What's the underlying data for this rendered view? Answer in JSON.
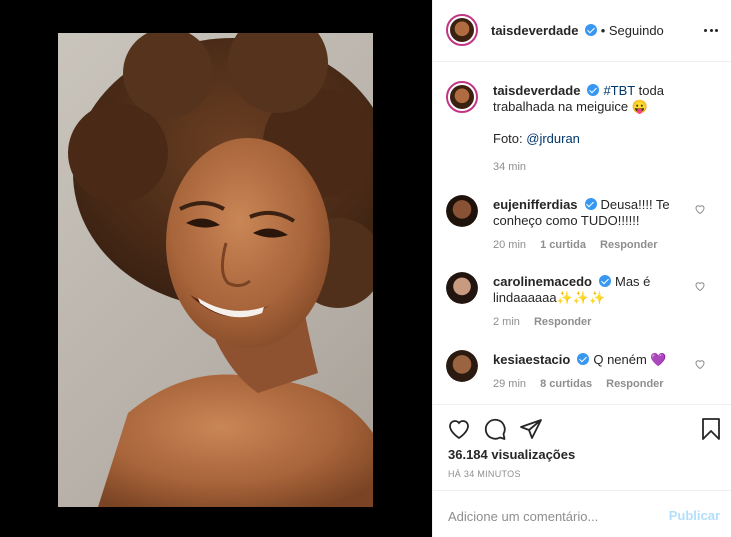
{
  "post": {
    "author": "taisdeverdade",
    "follow_status": "• Seguindo",
    "caption_username": "taisdeverdade",
    "caption_tag": "#TBT",
    "caption_text": "toda trabalhada na meiguice 😛",
    "caption_photo_prefix": "Foto:",
    "caption_photo_credit": "@jrduran",
    "caption_time": "34 min"
  },
  "comments": [
    {
      "username": "eujenifferdias",
      "text": "Deusa!!!! Te conheço como TUDO!!!!!!",
      "time": "20 min",
      "likes": "1 curtida",
      "reply": "Responder"
    },
    {
      "username": "carolinemacedo",
      "text": "Mas é lindaaaaaa✨✨✨",
      "time": "2 min",
      "reply": "Responder"
    },
    {
      "username": "kesiaestacio",
      "text": "Q neném 💜",
      "time": "29 min",
      "likes": "8 curtidas",
      "reply": "Responder"
    }
  ],
  "stats": {
    "views": "36.184 visualizações",
    "posted_ago": "HÁ 34 MINUTOS"
  },
  "comment_box": {
    "placeholder": "Adicione um comentário...",
    "post_label": "Publicar"
  },
  "icons": {
    "verified": "verified-badge-icon",
    "like": "heart-icon",
    "comment": "comment-bubble-icon",
    "share": "paper-plane-icon",
    "save": "bookmark-icon",
    "more": "more-options-icon"
  },
  "colors": {
    "verified": "#3897f0",
    "link": "#00376b",
    "muted": "#8e8e8e",
    "publish_disabled": "#b2dffc",
    "story_ring": "#c13584"
  }
}
